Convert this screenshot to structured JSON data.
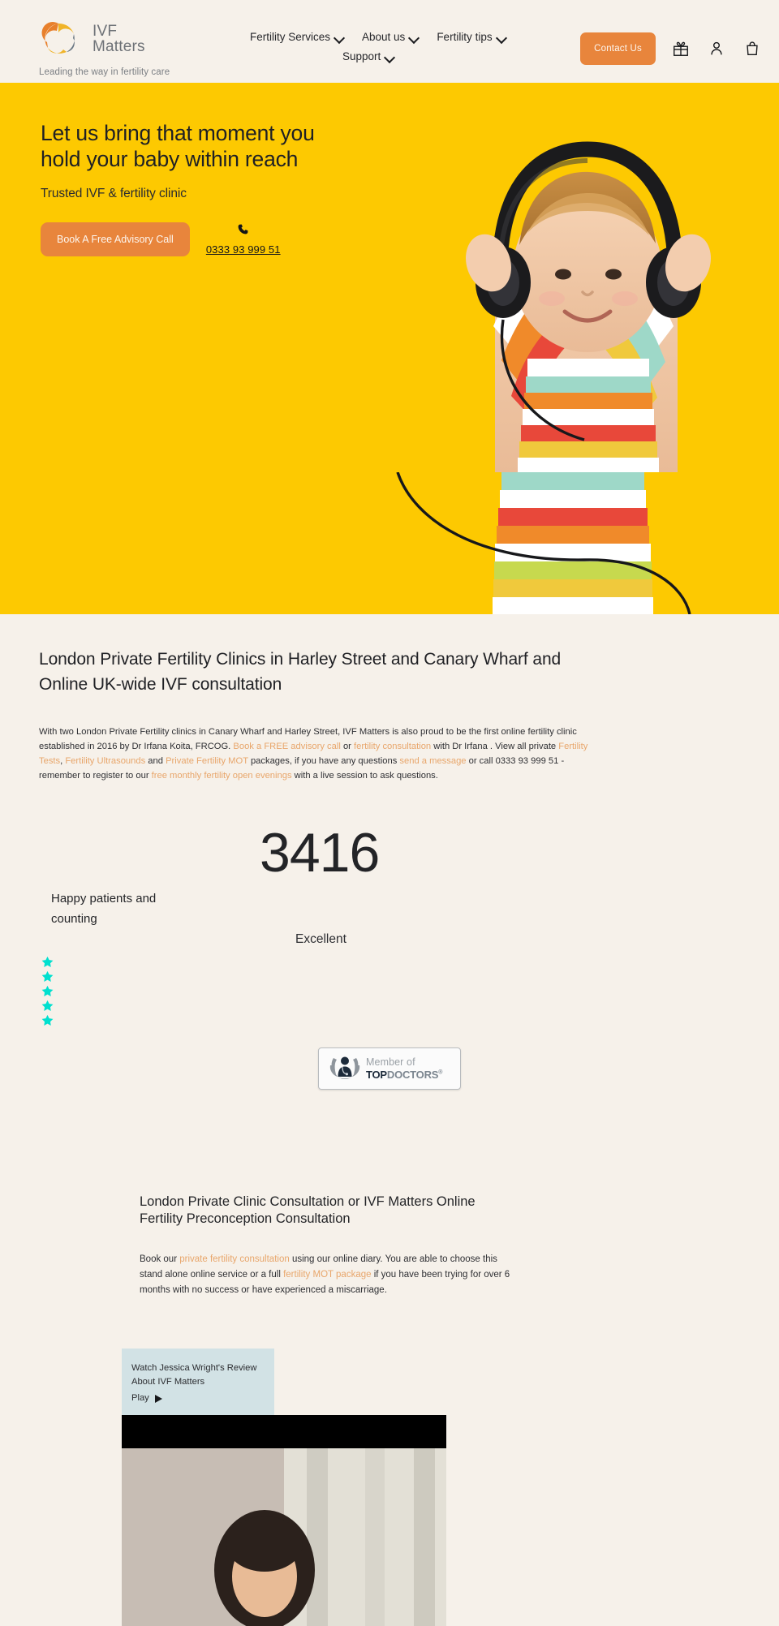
{
  "header": {
    "brand_name_line1": "IVF",
    "brand_name_line2": "Matters",
    "tagline": "Leading the way in fertility care",
    "nav": [
      {
        "label": "Fertility Services",
        "has_chevron": true
      },
      {
        "label": "About us",
        "has_chevron": true
      },
      {
        "label": "Fertility tips",
        "has_chevron": true
      },
      {
        "label": "Support",
        "has_chevron": true
      }
    ],
    "contact_button": "Contact Us",
    "icons": [
      "gift-icon",
      "account-icon",
      "bag-icon"
    ]
  },
  "hero": {
    "heading_line1": "Let us bring that moment you",
    "heading_line2": "hold your baby within reach",
    "subheading": "Trusted IVF & fertility clinic",
    "cta_label": "Book A Free Advisory Call",
    "phone": "0333 93 999 51",
    "background_color": "#fdc901"
  },
  "main": {
    "title": "London Private Fertility Clinics in Harley Street and Canary Wharf and Online UK-wide IVF consultation",
    "intro": {
      "t1": "With two London Private Fertility clinics in Canary Wharf and Harley Street, IVF Matters is also proud to be the first online fertility clinic established in 2016 by Dr Irfana Koita, FRCOG. ",
      "l1": "Book a FREE advisory call",
      "t2": " or ",
      "l2": "fertility consultation",
      "t3": " with Dr Irfana . View all private ",
      "l3": "Fertility Tests",
      "t4": ", ",
      "l4": "Fertility Ultrasounds",
      "t5": " and ",
      "l5": "Private Fertility MOT",
      "t6": " packages, if you have any questions ",
      "l6": "send a message",
      "t7": " or call 0333 93 999 51 - remember to register to our ",
      "l7": "free monthly fertility open evenings",
      "t8": " with a live session to ask questions."
    }
  },
  "stats": {
    "count": "3416",
    "count_label": "Happy patients and counting",
    "rating_label": "Excellent",
    "stars": 5,
    "star_color": "#00e0cf"
  },
  "badge": {
    "member_text": "Member of",
    "top": "TOP",
    "doctors": "DOCTORS",
    "registered": "®"
  },
  "consultation": {
    "title": "London Private Clinic Consultation or IVF Matters Online Fertility Preconception Consultation",
    "p1": "Book our ",
    "link1": "private fertility consultation",
    "p2": " using our online diary. You are able to choose this stand alone online service or a full ",
    "link2": "fertility MOT package",
    "p3": " if you have been trying for over 6 months with no success or have experienced a miscarriage."
  },
  "video": {
    "caption_line1": "Watch Jessica Wright's Review",
    "caption_line2": "About IVF Matters",
    "play_label": "Play",
    "caption_bg": "#d2e2e5"
  }
}
